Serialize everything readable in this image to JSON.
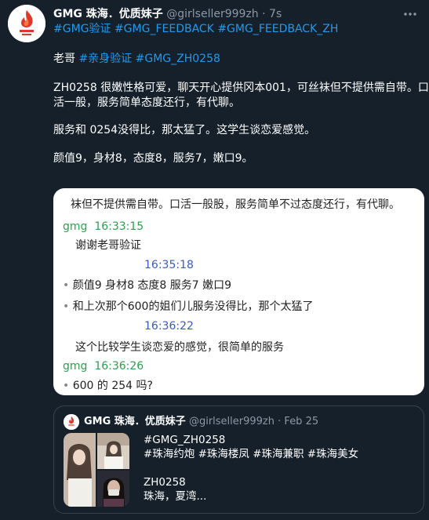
{
  "tweet": {
    "author_name": "GMG 珠海．优质妹子",
    "handle": "@girlseller999zh",
    "separator": "·",
    "time": "7s",
    "avatar_text": "GMG优质\n妹子",
    "hashtags_line": "#GMG验证 #GMG_FEEDBACK #GMG_FEEDBACK_ZH",
    "body_line1_prefix": "老哥 ",
    "body_line1_tags": "#亲身验证 #GMG_ZH0258",
    "body_line2": "ZH0258 很嫩性格可爱，聊天开心提供冈本001，可丝袜但不提供需自带。口",
    "body_line3": "活一般，服务简单态度还行，有代聊。",
    "body_line4": "服务和 0254没得比，那太猛了。这学生谈恋爱感觉。",
    "body_line5": "颜值9，身材8，态度8，服务7，嫩口9。"
  },
  "chat_screenshot": {
    "line1": "袜但不提供需自带。口活一般股，服务简单不过态度还行，有代聊。",
    "sender1": "gmg",
    "time1": "16:33:15",
    "msg1": "谢谢老哥验证",
    "time2": "16:35:18",
    "msg2": "颜值9 身材8 态度8 服务7 嫩口9",
    "msg3": "和上次那个600的姐们儿服务没得比，那个太猛了",
    "time3": "16:36:22",
    "msg4": "这个比较学生谈恋爱的感觉，很简单的服务",
    "sender2": "gmg",
    "time4": "16:36:26",
    "msg5": "600 的 254 吗?",
    "bullet": "•"
  },
  "quote": {
    "author_name": "GMG 珠海．优质妹子",
    "handle": "@girlseller999zh",
    "separator": "·",
    "date": "Feb 25",
    "line1": "#GMG_ZH0258",
    "line2": "#珠海约炮 #珠海楼凤 #珠海兼职 #珠海美女",
    "line3": "ZH0258",
    "line4": "珠海，夏湾..."
  },
  "colors": {
    "background": "#15202b",
    "link": "#1d9bf0",
    "muted": "#8b98a5",
    "border": "#38444d"
  }
}
